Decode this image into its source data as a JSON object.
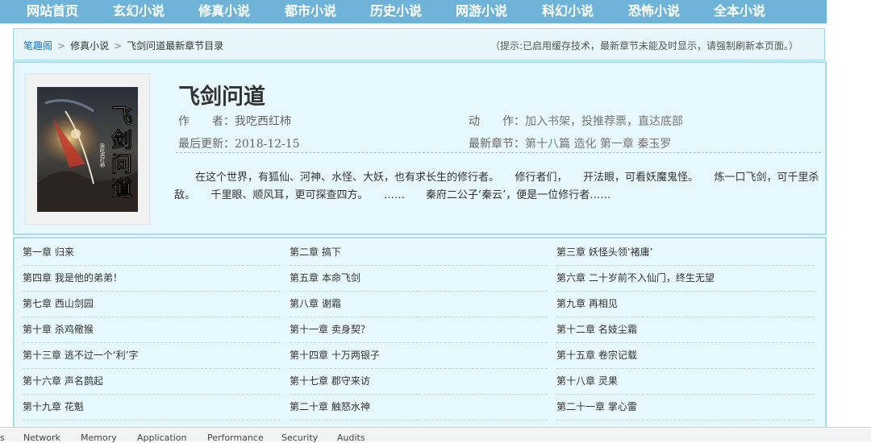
{
  "nav": [
    {
      "label": "网站首页"
    },
    {
      "label": "玄幻小说"
    },
    {
      "label": "修真小说"
    },
    {
      "label": "都市小说"
    },
    {
      "label": "历史小说"
    },
    {
      "label": "网游小说"
    },
    {
      "label": "科幻小说"
    },
    {
      "label": "恐怖小说"
    },
    {
      "label": "全本小说"
    }
  ],
  "breadcrumb": {
    "home": "笔趣阁",
    "separator": ">",
    "category": "修真小说",
    "current": "飞剑问道最新章节目录"
  },
  "tip": "（提示:已启用缓存技术，最新章节未能及时显示，请强制刷新本页面。）",
  "book": {
    "cover_title": "飞剑问道",
    "cover_author": "我吃西红柿",
    "title": "飞剑问道",
    "author_label": "作　　者：",
    "author": "我吃西红柿",
    "action_label": "动　　作：",
    "action_add": "加入书架",
    "action_vote": "投推荐票",
    "action_bottom": "直达底部",
    "action_sep": "，",
    "updated_label": "最后更新：",
    "updated": "2018-12-15",
    "latest_label": "最新章节：",
    "latest": "第十八篇 造化 第一章 秦玉罗",
    "description": "在这个世界，有狐仙、河神、水怪、大妖，也有求长生的修行者。　　修行者们，　　开法眼，可看妖魔鬼怪。　　炼一口飞剑，可千里杀敌。　　千里眼、顺风耳，更可探查四方。　　……　　秦府二公子‘秦云’，便是一位修行者……"
  },
  "chapters": [
    [
      "第一章 归来",
      "第二章 搞下",
      "第三章 妖怪头领‘褚庸’"
    ],
    [
      "第四章 我是他的弟弟！",
      "第五章 本命飞剑",
      "第六章 二十岁前不入仙门，终生无望"
    ],
    [
      "第七章 西山剑园",
      "第八章 谢霜",
      "第九章 再相见"
    ],
    [
      "第十章 杀鸡儆猴",
      "第十一章 卖身契？",
      "第十二章 名妓尘霜"
    ],
    [
      "第十三章 逃不过一个‘利’字",
      "第十四章 十万两银子",
      "第十五章 卷宗记载"
    ],
    [
      "第十六章 声名鹊起",
      "第十七章 郡守来访",
      "第十八章 灵果"
    ],
    [
      "第十九章 花魁",
      "第二十章 触怒水神",
      "第二十一章 掌心雷"
    ]
  ],
  "devtools_tabs": [
    "s",
    "Network",
    "Memory",
    "Application",
    "Performance",
    "Security",
    "Audits"
  ],
  "colors": {
    "nav_bg": "#6fb4d8",
    "panel_bg": "#e6f7fd",
    "panel_border": "#a6dbec"
  }
}
